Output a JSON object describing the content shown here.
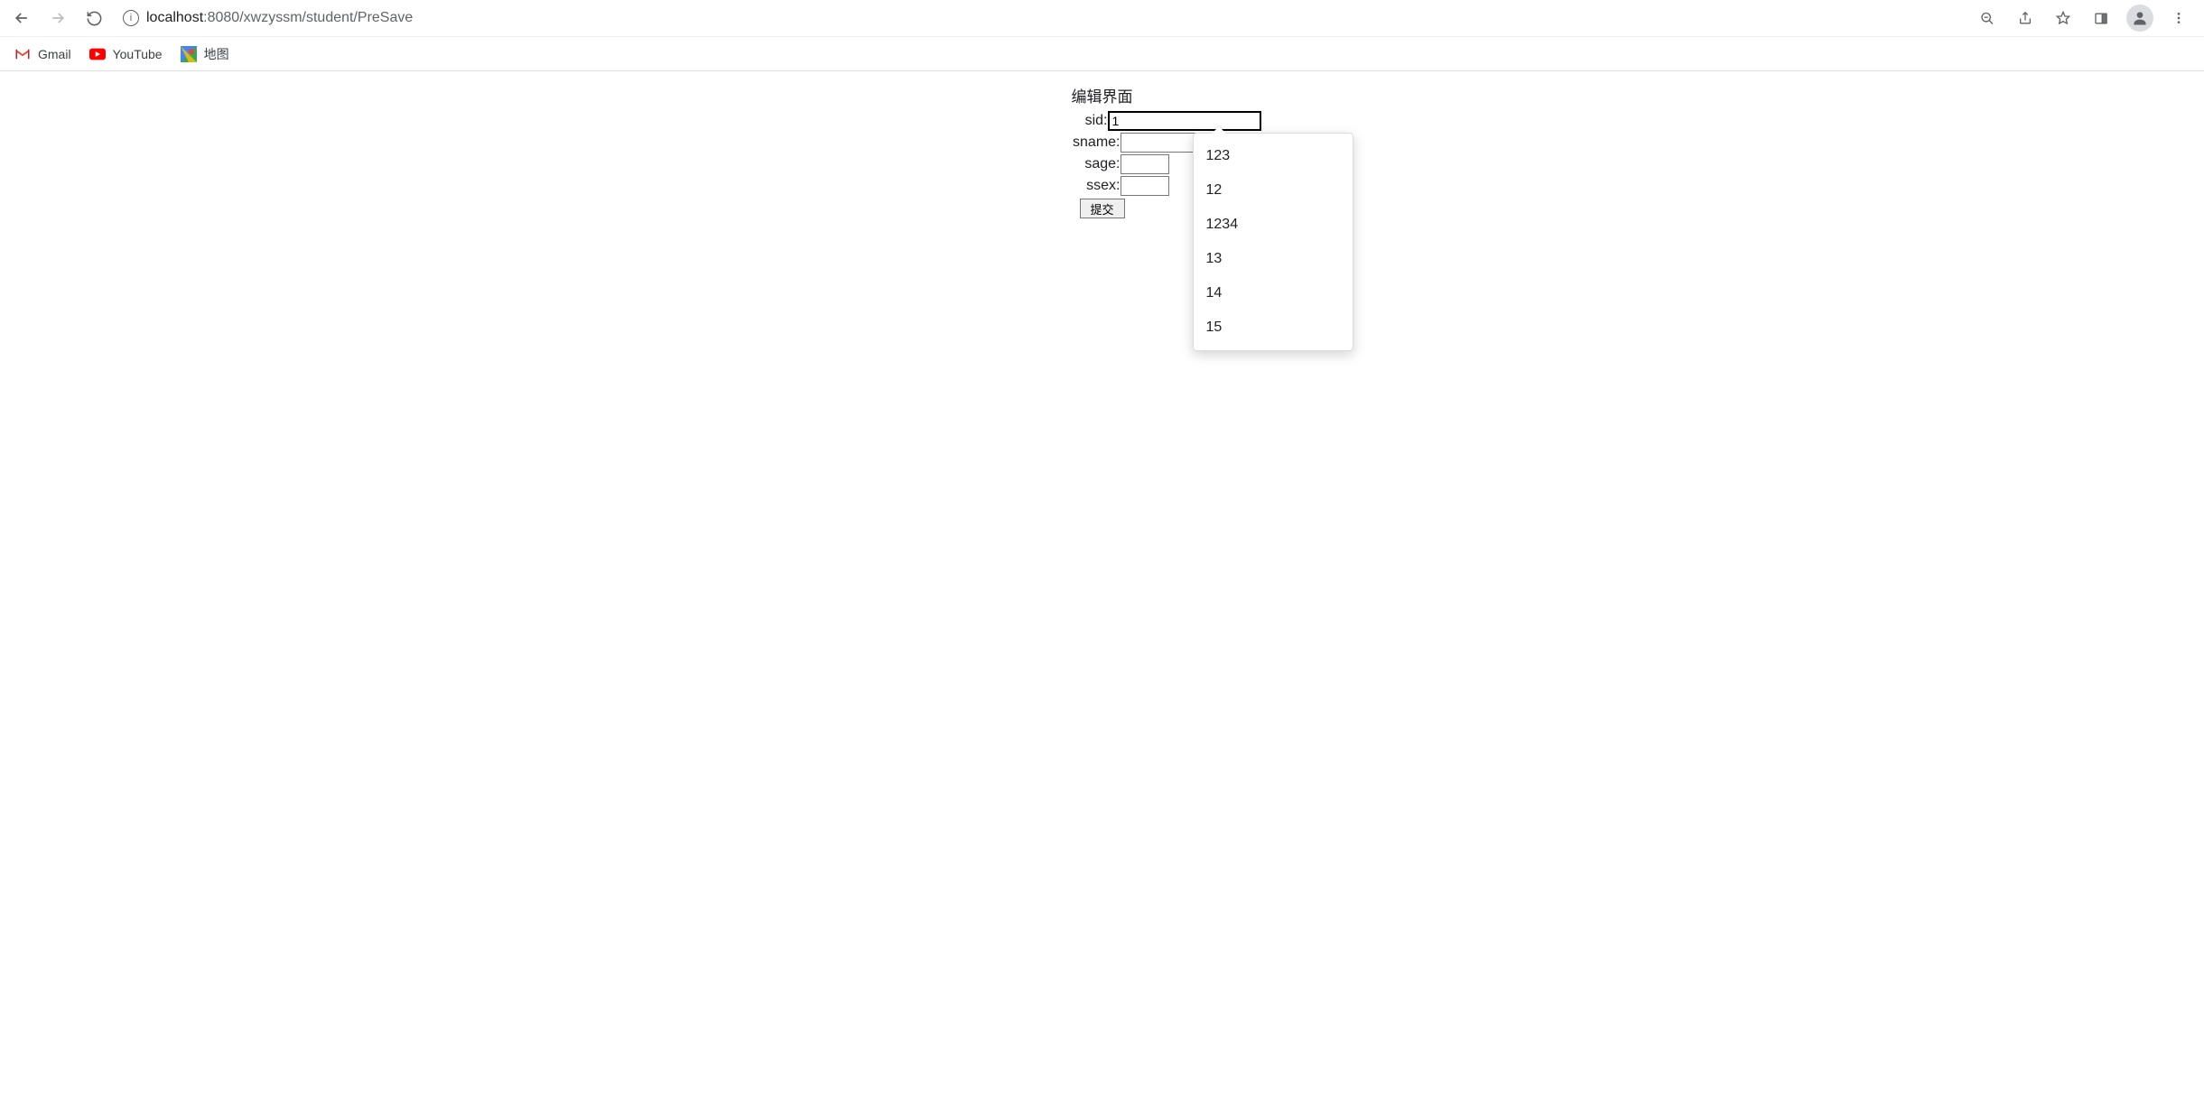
{
  "browser": {
    "url_host": "localhost",
    "url_port": ":8080",
    "url_path": "/xwzyssm/student/PreSave"
  },
  "bookmarks": [
    {
      "label": "Gmail"
    },
    {
      "label": "YouTube"
    },
    {
      "label": "地图"
    }
  ],
  "page": {
    "title": "编辑界面",
    "fields": {
      "sid": {
        "label": "sid:",
        "value": "1"
      },
      "sname": {
        "label": "sname:",
        "value": ""
      },
      "sage": {
        "label": "sage:",
        "value": ""
      },
      "ssex": {
        "label": "ssex:",
        "value": ""
      }
    },
    "submit_label": "提交"
  },
  "autocomplete": {
    "items": [
      "123",
      "12",
      "1234",
      "13",
      "14",
      "15"
    ]
  }
}
